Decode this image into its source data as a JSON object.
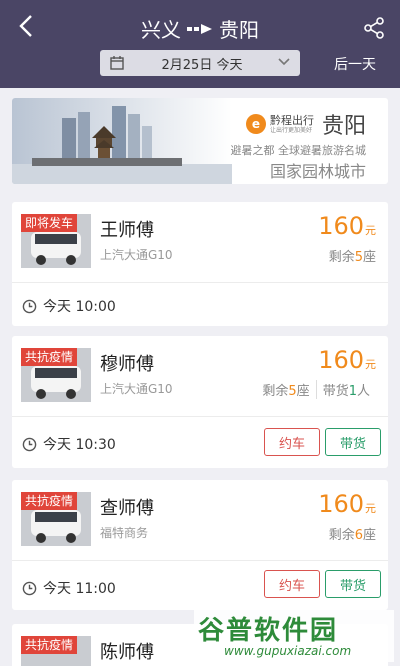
{
  "header": {
    "from": "兴义",
    "to": "贵阳",
    "date": "2月25日 今天",
    "next_day": "后一天"
  },
  "banner": {
    "brand": "黔程出行",
    "brand_tagline": "让出行更加美好",
    "city": "贵阳",
    "slogan": "避暑之都  全球避暑旅游名城",
    "subtitle": "国家园林城市"
  },
  "trips": [
    {
      "tag": "即将发车",
      "driver": "王师傅",
      "model": "上汽大通G10",
      "price": "160",
      "unit": "元",
      "seats_label": "剩余",
      "seats": "5",
      "seats_unit": "座",
      "time": "今天 10:00"
    },
    {
      "tag": "共抗疫情",
      "driver": "穆师傅",
      "model": "上汽大通G10",
      "price": "160",
      "unit": "元",
      "seats_label": "剩余",
      "seats": "5",
      "seats_unit": "座",
      "cargo_label": "带货",
      "cargo": "1",
      "cargo_unit": "人",
      "time": "今天 10:30",
      "book": "约车",
      "cargo_btn": "带货"
    },
    {
      "tag": "共抗疫情",
      "driver": "查师傅",
      "model": "福特商务",
      "price": "160",
      "unit": "元",
      "seats_label": "剩余",
      "seats": "6",
      "seats_unit": "座",
      "time": "今天 11:00",
      "book": "约车",
      "cargo_btn": "带货"
    },
    {
      "tag": "共抗疫情",
      "driver": "陈师傅"
    }
  ],
  "watermark": {
    "text": "谷普软件园",
    "url": "www.gupuxiazai.com"
  },
  "colors": {
    "header_bg": "#4a4565",
    "price": "#f08a1c",
    "book": "#d9534f",
    "cargo": "#2a9d6a",
    "tag": "#e0453a"
  }
}
